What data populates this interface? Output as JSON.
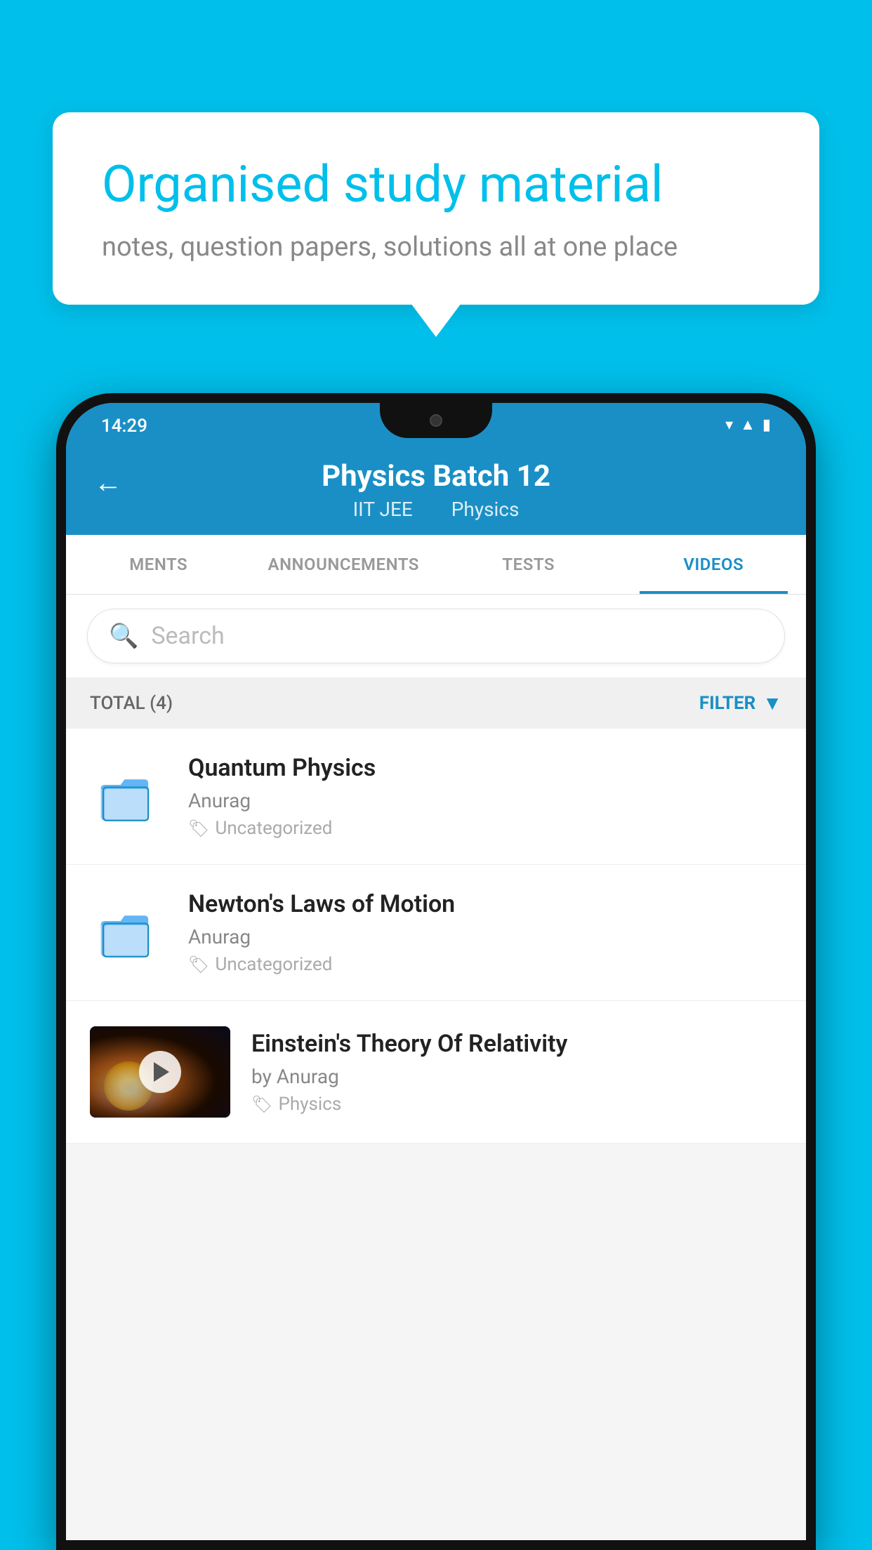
{
  "background_color": "#00BFEA",
  "bubble": {
    "title": "Organised study material",
    "subtitle": "notes, question papers, solutions all at one place"
  },
  "status_bar": {
    "time": "14:29",
    "icons": [
      "wifi",
      "signal",
      "battery"
    ]
  },
  "header": {
    "title": "Physics Batch 12",
    "subtitle1": "IIT JEE",
    "subtitle2": "Physics",
    "back_label": "←"
  },
  "tabs": [
    {
      "label": "MENTS",
      "active": false
    },
    {
      "label": "ANNOUNCEMENTS",
      "active": false
    },
    {
      "label": "TESTS",
      "active": false
    },
    {
      "label": "VIDEOS",
      "active": true
    }
  ],
  "search": {
    "placeholder": "Search"
  },
  "filter": {
    "total_label": "TOTAL (4)",
    "filter_label": "FILTER"
  },
  "videos": [
    {
      "id": 1,
      "title": "Quantum Physics",
      "author": "Anurag",
      "tag": "Uncategorized",
      "type": "folder"
    },
    {
      "id": 2,
      "title": "Newton's Laws of Motion",
      "author": "Anurag",
      "tag": "Uncategorized",
      "type": "folder"
    },
    {
      "id": 3,
      "title": "Einstein's Theory Of Relativity",
      "author": "by Anurag",
      "tag": "Physics",
      "type": "video"
    }
  ]
}
